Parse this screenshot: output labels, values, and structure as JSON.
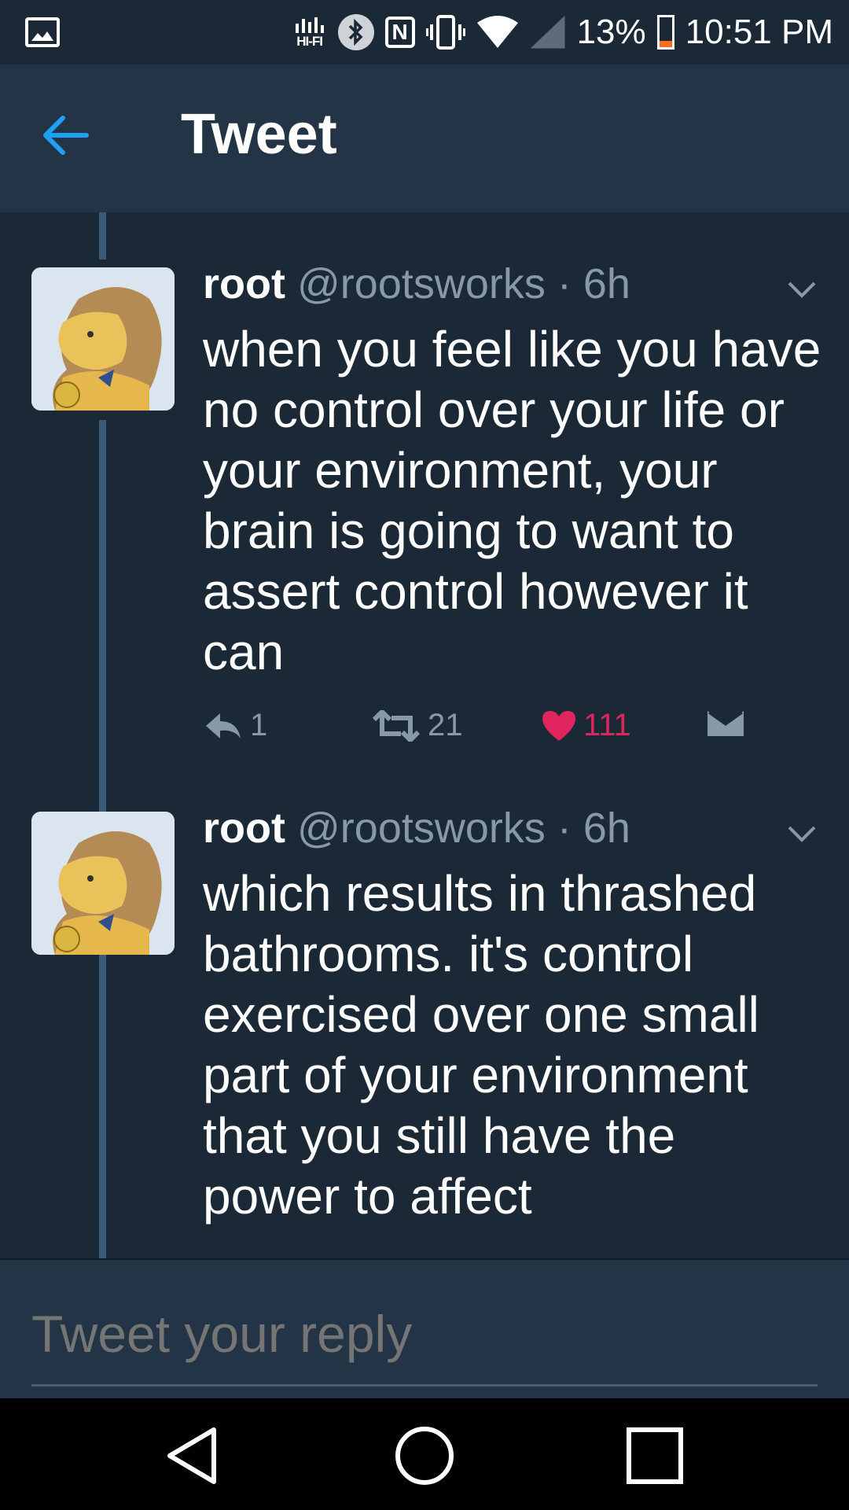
{
  "status_bar": {
    "hifi": "HI-FI",
    "nfc": "N",
    "battery": "13%",
    "time": "10:51 PM",
    "battery_color": "#f36d22"
  },
  "header": {
    "title": "Tweet"
  },
  "tweets": [
    {
      "name": "root",
      "handle": "@rootsworks · 6h",
      "text": "when you feel like you have no control over your life or your environment, your brain is going to want to assert control however it can",
      "replies": "1",
      "retweets": "21",
      "likes": "111",
      "liked": true
    },
    {
      "name": "root",
      "handle": "@rootsworks · 6h",
      "text": "which results in thrashed bathrooms. it's control exercised over one small part of your environment that you still have the power to affect"
    }
  ],
  "composer": {
    "placeholder": "Tweet your reply"
  },
  "colors": {
    "background": "#1b2836",
    "header": "#243447",
    "accent": "#1da1f2",
    "like": "#e0245e",
    "muted": "#8899a6"
  },
  "icons": [
    "image-icon",
    "hifi-icon",
    "bluetooth-icon",
    "nfc-icon",
    "vibrate-icon",
    "wifi-icon",
    "signal-icon",
    "battery-icon",
    "back-arrow-icon",
    "avatar-lion",
    "chevron-down-icon",
    "reply-icon",
    "retweet-icon",
    "heart-icon",
    "direct-message-icon",
    "nav-back-icon",
    "nav-home-icon",
    "nav-recents-icon"
  ]
}
